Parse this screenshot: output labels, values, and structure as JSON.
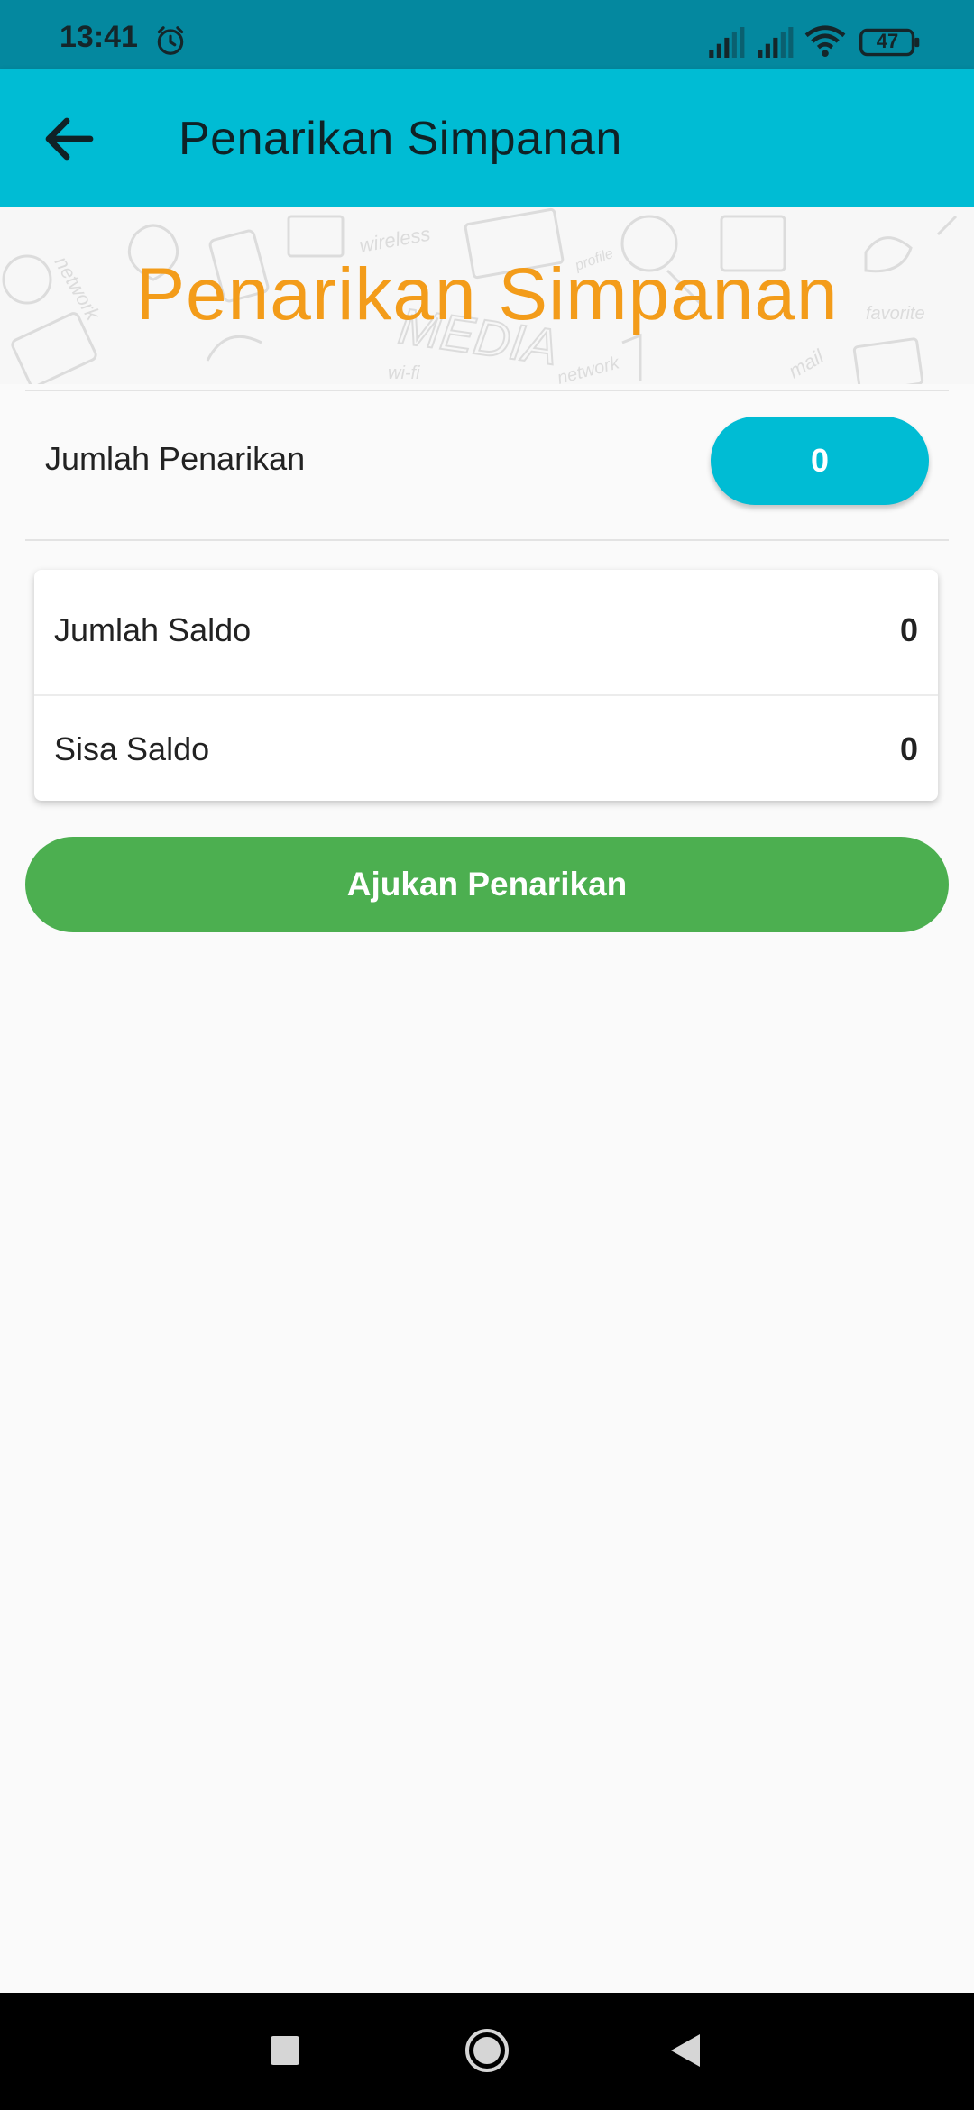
{
  "status_bar": {
    "time": "13:41",
    "battery": "47",
    "icons": [
      "alarm-icon",
      "signal-icon",
      "signal-icon",
      "wifi-icon",
      "battery-icon"
    ]
  },
  "app_bar": {
    "back_icon": "arrow-left-icon",
    "title": "Penarikan Simpanan"
  },
  "banner": {
    "title": "Penarikan Simpanan"
  },
  "withdrawal": {
    "label": "Jumlah Penarikan",
    "value": "0"
  },
  "summary": {
    "rows": [
      {
        "label": "Jumlah Saldo",
        "value": "0"
      },
      {
        "label": "Sisa Saldo",
        "value": "0"
      }
    ]
  },
  "actions": {
    "submit_label": "Ajukan Penarikan"
  },
  "nav_bar": {
    "icons": [
      "recents-icon",
      "home-icon",
      "back-icon"
    ]
  },
  "colors": {
    "status_bar": "#04889f",
    "app_bar": "#00bcd4",
    "banner_title": "#f39c1a",
    "input_pill": "#00bcd4",
    "submit_button": "#4caf50",
    "background": "#fafafa"
  }
}
